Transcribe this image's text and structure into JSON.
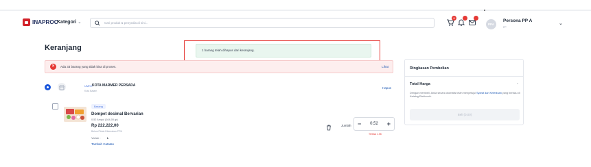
{
  "header": {
    "logo_text": "INAPROC",
    "logo_sub": "",
    "kategori_label": "Kategori",
    "search_placeholder": "Cari produk & penyedia di sini...",
    "badges": {
      "cart": "2",
      "notif": "",
      "inbox": ""
    },
    "avatar_initials": "PPA",
    "user_name": "Persona PP A",
    "user_role": "PP"
  },
  "cart": {
    "title": "Keranjang",
    "toast_text": "1 barang telah dihapus dari keranjang.",
    "alert_text": "Ada 33 barang yang tidak bisa di proses.",
    "alert_link": "Lihat",
    "store": {
      "tag": "UMKK",
      "name": "KOTA MARMER PERSADA",
      "location": "Kota Batam",
      "delete_label": "Hapus"
    },
    "item": {
      "tag": "Barang",
      "name": "Dompet desimal Bervarian",
      "qty_unit": "0,52 Ampul (164,00 gr)",
      "price": "Rp 222.222,00",
      "tax_note": "Belum/Tidak Dikenakan PPN",
      "variant_label": "Varian :",
      "variant_value": "L",
      "note_link": "Tambah Catatan",
      "quantity_label": "Jumlah",
      "quantity_value": "0,52",
      "stock_note": "Tersisa 1.56"
    }
  },
  "summary": {
    "title": "Ringkasan Pembelian",
    "total_label": "Total Harga",
    "total_value": "-",
    "note_prefix": "Dengan membeli, Anda secara otomatis telah menyetujui ",
    "note_link": "Syarat dan Ketentuan",
    "note_suffix": " yang berlaku di Katalog Elektronik.",
    "buy_button": "Beli (0,00)"
  },
  "colors": {
    "brand_red": "#d2232a",
    "link_blue": "#1a56b3",
    "primary_blue": "#1a56db",
    "toast_bg": "#e9f6ef",
    "alert_bg": "#fdeeee",
    "highlight_outline": "#e53935"
  },
  "icons": [
    "logo-icon",
    "chevron-down-icon",
    "search-icon",
    "cart-icon",
    "notification-icon",
    "inbox-icon",
    "alert-icon",
    "store-icon",
    "trash-icon"
  ]
}
